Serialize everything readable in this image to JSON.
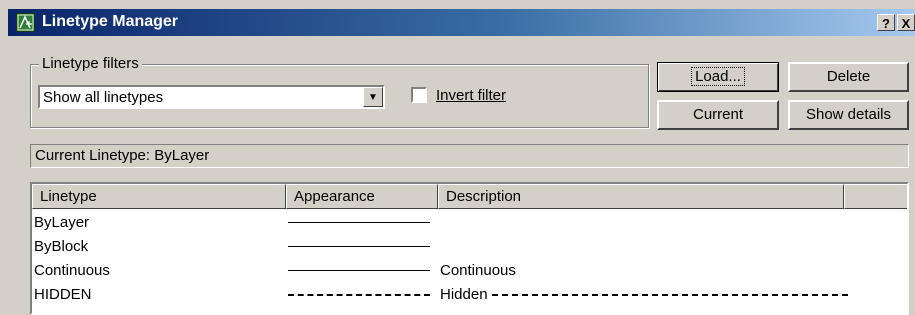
{
  "window": {
    "title": "Linetype Manager",
    "help_label": "?",
    "close_label": "X"
  },
  "filters": {
    "group_label": "Linetype filters",
    "selected": "Show all linetypes",
    "invert_label": "Invert filter",
    "invert_checked": false
  },
  "buttons": {
    "load": "Load...",
    "delete": "Delete",
    "current": "Current",
    "show_details": "Show details"
  },
  "current_linetype": "Current Linetype:  ByLayer",
  "table": {
    "columns": [
      "Linetype",
      "Appearance",
      "Description"
    ],
    "rows": [
      {
        "name": "ByLayer",
        "appearance": "solid",
        "description": ""
      },
      {
        "name": "ByBlock",
        "appearance": "solid",
        "description": ""
      },
      {
        "name": "Continuous",
        "appearance": "solid",
        "description": "Continuous"
      },
      {
        "name": "HIDDEN",
        "appearance": "dashed",
        "description": "Hidden"
      }
    ]
  },
  "colors": {
    "title_gradient_start": "#0a246a",
    "title_gradient_end": "#a6caf0",
    "face": "#d4d0c8"
  }
}
